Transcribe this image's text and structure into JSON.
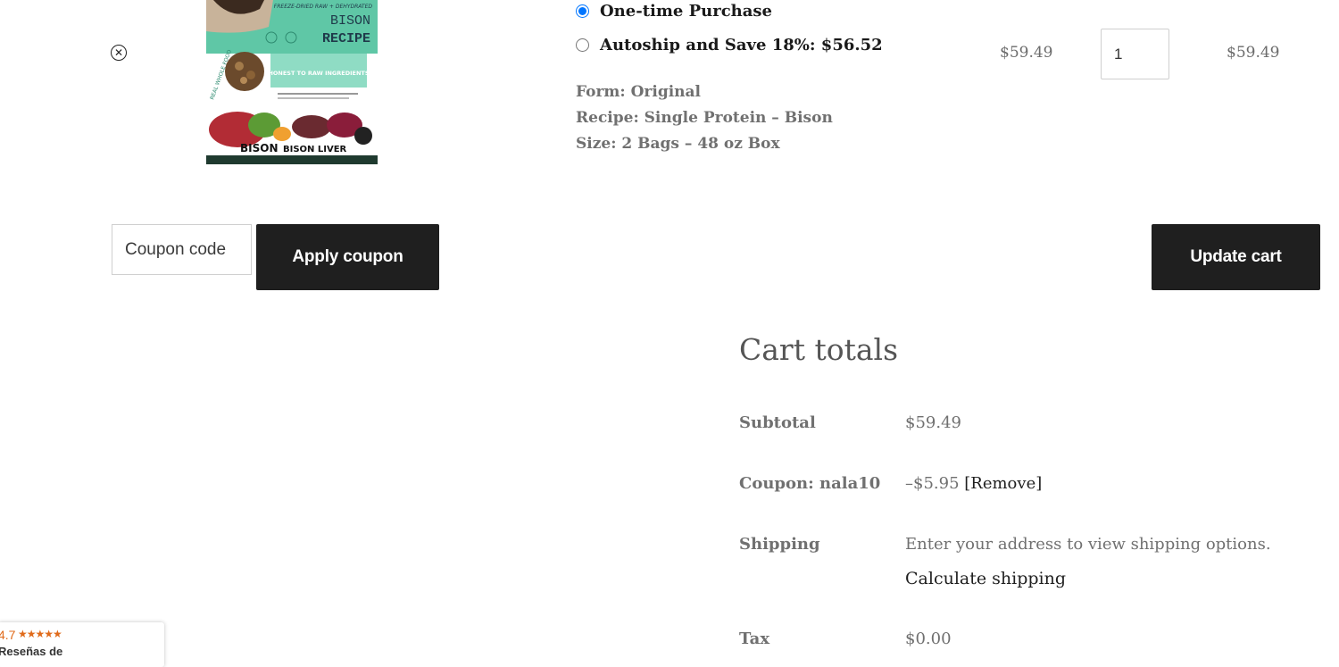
{
  "cart_item": {
    "remove_icon": "close-circle-icon",
    "image": {
      "text_top": "FREEZE-DRIED RAW + DEHYDRATED",
      "title_1": "BISON",
      "title_2": "RECIPE",
      "badge": "HONEST TO RAW INGREDIENTS",
      "side_text": "REAL WHOLE FOOD",
      "bottom_1": "BISON",
      "bottom_2": "BISON LIVER"
    },
    "options": [
      {
        "label": "One-time Purchase",
        "selected": true
      },
      {
        "label": "Autoship and Save 18%: $56.52",
        "selected": false
      }
    ],
    "meta": [
      "Form: Original",
      "Recipe: Single Protein – Bison",
      "Size: 2 Bags – 48 oz Box"
    ],
    "price": "$59.49",
    "quantity": "1",
    "line_total": "$59.49"
  },
  "coupon": {
    "placeholder": "Coupon code",
    "apply_label": "Apply coupon"
  },
  "update_label": "Update cart",
  "totals": {
    "title": "Cart totals",
    "subtotal_label": "Subtotal",
    "subtotal_value": "$59.49",
    "coupon_label": "Coupon: nala10",
    "coupon_value": "–$5.95",
    "coupon_remove": "[Remove]",
    "shipping_label": "Shipping",
    "shipping_value": "Enter your address to view shipping options.",
    "calc_shipping": "Calculate shipping",
    "tax_label": "Tax",
    "tax_value": "$0.00"
  },
  "review_badge": {
    "rating": "4.7",
    "stars": "★★★★★",
    "text": "Reseñas de"
  },
  "colors": {
    "button_bg": "#1f1f1f",
    "radio_accent": "#1a73e8"
  }
}
